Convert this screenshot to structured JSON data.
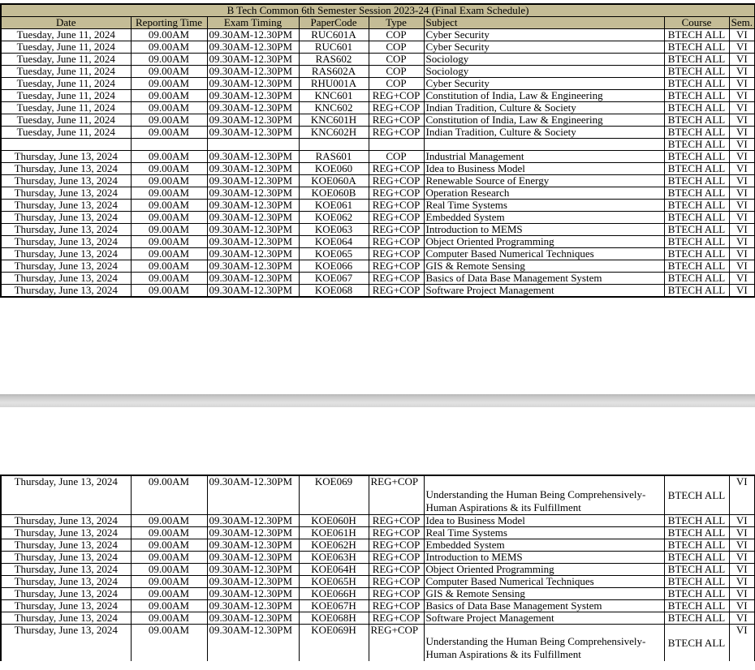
{
  "document": {
    "title": "B Tech Common 6th Semester  Session 2023-24 (Final Exam Schedule)",
    "columns": [
      "Date",
      "Reporting Time",
      "Exam Timing",
      "PaperCode",
      "Type",
      "Subject",
      "Course",
      "Sem."
    ]
  },
  "page1_rows": [
    {
      "date": "Tuesday, June 11, 2024",
      "reporting": "09.00AM",
      "timing": "09.30AM-12.30PM",
      "code": "RUC601A",
      "type": "COP",
      "subject": "Cyber Security",
      "course": "BTECH ALL",
      "sem": "VI"
    },
    {
      "date": "Tuesday, June 11, 2024",
      "reporting": "09.00AM",
      "timing": "09.30AM-12.30PM",
      "code": "RUC601",
      "type": "COP",
      "subject": "Cyber Security",
      "course": "BTECH ALL",
      "sem": "VI"
    },
    {
      "date": "Tuesday, June 11, 2024",
      "reporting": "09.00AM",
      "timing": "09.30AM-12.30PM",
      "code": "RAS602",
      "type": "COP",
      "subject": "Sociology",
      "course": "BTECH ALL",
      "sem": "VI"
    },
    {
      "date": "Tuesday, June 11, 2024",
      "reporting": "09.00AM",
      "timing": "09.30AM-12.30PM",
      "code": "RAS602A",
      "type": "COP",
      "subject": "Sociology",
      "course": "BTECH ALL",
      "sem": "VI"
    },
    {
      "date": "Tuesday, June 11, 2024",
      "reporting": "09.00AM",
      "timing": "09.30AM-12.30PM",
      "code": "RHU001A",
      "type": "COP",
      "subject": "Cyber Security",
      "course": "BTECH ALL",
      "sem": "VI"
    },
    {
      "date": "Tuesday, June 11, 2024",
      "reporting": "09.00AM",
      "timing": "09.30AM-12.30PM",
      "code": "KNC601",
      "type": "REG+COP",
      "subject": "Constitution of India, Law & Engineering",
      "course": "BTECH ALL",
      "sem": "VI"
    },
    {
      "date": "Tuesday, June 11, 2024",
      "reporting": "09.00AM",
      "timing": "09.30AM-12.30PM",
      "code": "KNC602",
      "type": "REG+COP",
      "subject": "Indian Tradition, Culture & Society",
      "course": "BTECH ALL",
      "sem": "VI"
    },
    {
      "date": "Tuesday, June 11, 2024",
      "reporting": "09.00AM",
      "timing": "09.30AM-12.30PM",
      "code": "KNC601H",
      "type": "REG+COP",
      "subject": "Constitution of India, Law & Engineering",
      "course": "BTECH ALL",
      "sem": "VI"
    },
    {
      "date": "Tuesday, June 11, 2024",
      "reporting": "09.00AM",
      "timing": "09.30AM-12.30PM",
      "code": "KNC602H",
      "type": "REG+COP",
      "subject": "Indian Tradition, Culture & Society",
      "course": "BTECH ALL",
      "sem": "VI"
    },
    {
      "date": "",
      "reporting": "",
      "timing": "",
      "code": "",
      "type": "",
      "subject": "",
      "course": "BTECH ALL",
      "sem": "VI"
    },
    {
      "date": "Thursday, June 13, 2024",
      "reporting": "09.00AM",
      "timing": "09.30AM-12.30PM",
      "code": "RAS601",
      "type": "COP",
      "subject": "Industrial Management",
      "course": "BTECH ALL",
      "sem": "VI"
    },
    {
      "date": "Thursday, June 13, 2024",
      "reporting": "09.00AM",
      "timing": "09.30AM-12.30PM",
      "code": "KOE060",
      "type": "REG+COP",
      "subject": "Idea to Business Model",
      "course": "BTECH ALL",
      "sem": "VI"
    },
    {
      "date": "Thursday, June 13, 2024",
      "reporting": "09.00AM",
      "timing": "09.30AM-12.30PM",
      "code": "KOE060A",
      "type": "REG+COP",
      "subject": "Renewable Source of Energy",
      "course": "BTECH ALL",
      "sem": "VI"
    },
    {
      "date": "Thursday, June 13, 2024",
      "reporting": "09.00AM",
      "timing": "09.30AM-12.30PM",
      "code": "KOE060B",
      "type": "REG+COP",
      "subject": "Operation Research",
      "course": "BTECH ALL",
      "sem": "VI"
    },
    {
      "date": "Thursday, June 13, 2024",
      "reporting": "09.00AM",
      "timing": "09.30AM-12.30PM",
      "code": "KOE061",
      "type": "REG+COP",
      "subject": "Real Time Systems",
      "course": "BTECH ALL",
      "sem": "VI"
    },
    {
      "date": "Thursday, June 13, 2024",
      "reporting": "09.00AM",
      "timing": "09.30AM-12.30PM",
      "code": "KOE062",
      "type": "REG+COP",
      "subject": "Embedded System",
      "course": "BTECH ALL",
      "sem": "VI"
    },
    {
      "date": "Thursday, June 13, 2024",
      "reporting": "09.00AM",
      "timing": "09.30AM-12.30PM",
      "code": "KOE063",
      "type": "REG+COP",
      "subject": "Introduction to MEMS",
      "course": "BTECH ALL",
      "sem": "VI"
    },
    {
      "date": "Thursday, June 13, 2024",
      "reporting": "09.00AM",
      "timing": "09.30AM-12.30PM",
      "code": "KOE064",
      "type": "REG+COP",
      "subject": "Object Oriented Programming",
      "course": "BTECH ALL",
      "sem": "VI"
    },
    {
      "date": "Thursday, June 13, 2024",
      "reporting": "09.00AM",
      "timing": "09.30AM-12.30PM",
      "code": "KOE065",
      "type": "REG+COP",
      "subject": "Computer Based Numerical Techniques",
      "course": "BTECH ALL",
      "sem": "VI"
    },
    {
      "date": "Thursday, June 13, 2024",
      "reporting": "09.00AM",
      "timing": "09.30AM-12.30PM",
      "code": "KOE066",
      "type": "REG+COP",
      "subject": "GIS & Remote Sensing",
      "course": "BTECH ALL",
      "sem": "VI"
    },
    {
      "date": "Thursday, June 13, 2024",
      "reporting": "09.00AM",
      "timing": "09.30AM-12.30PM",
      "code": "KOE067",
      "type": "REG+COP",
      "subject": "Basics of Data Base Management System",
      "course": "BTECH ALL",
      "sem": "VI"
    },
    {
      "date": "Thursday, June 13, 2024",
      "reporting": "09.00AM",
      "timing": "09.30AM-12.30PM",
      "code": "KOE068",
      "type": "REG+COP",
      "subject": "Software Project Management",
      "course": "BTECH ALL",
      "sem": "VI"
    }
  ],
  "page2_rows": [
    {
      "date": "Thursday, June 13, 2024",
      "reporting": "09.00AM",
      "timing": "09.30AM-12.30PM",
      "code": "KOE069",
      "type": "REG+COP",
      "subject": "Understanding the Human Being Comprehensively- Human Aspirations & its Fulfillment",
      "course": "BTECH ALL",
      "sem": "VI",
      "tall": true
    },
    {
      "date": "Thursday, June 13, 2024",
      "reporting": "09.00AM",
      "timing": "09.30AM-12.30PM",
      "code": "KOE060H",
      "type": "REG+COP",
      "subject": "Idea to Business Model",
      "course": "BTECH ALL",
      "sem": "VI"
    },
    {
      "date": "Thursday, June 13, 2024",
      "reporting": "09.00AM",
      "timing": "09.30AM-12.30PM",
      "code": "KOE061H",
      "type": "REG+COP",
      "subject": "Real Time Systems",
      "course": "BTECH ALL",
      "sem": "VI"
    },
    {
      "date": "Thursday, June 13, 2024",
      "reporting": "09.00AM",
      "timing": "09.30AM-12.30PM",
      "code": "KOE062H",
      "type": "REG+COP",
      "subject": "Embedded System",
      "course": "BTECH ALL",
      "sem": "VI"
    },
    {
      "date": "Thursday, June 13, 2024",
      "reporting": "09.00AM",
      "timing": "09.30AM-12.30PM",
      "code": "KOE063H",
      "type": "REG+COP",
      "subject": "Introduction to MEMS",
      "course": "BTECH ALL",
      "sem": "VI"
    },
    {
      "date": "Thursday, June 13, 2024",
      "reporting": "09.00AM",
      "timing": "09.30AM-12.30PM",
      "code": "KOE064H",
      "type": "REG+COP",
      "subject": "Object Oriented Programming",
      "course": "BTECH ALL",
      "sem": "VI"
    },
    {
      "date": "Thursday, June 13, 2024",
      "reporting": "09.00AM",
      "timing": "09.30AM-12.30PM",
      "code": "KOE065H",
      "type": "REG+COP",
      "subject": "Computer Based Numerical Techniques",
      "course": "BTECH ALL",
      "sem": "VI"
    },
    {
      "date": "Thursday, June 13, 2024",
      "reporting": "09.00AM",
      "timing": "09.30AM-12.30PM",
      "code": "KOE066H",
      "type": "REG+COP",
      "subject": "GIS & Remote Sensing",
      "course": "BTECH ALL",
      "sem": "VI"
    },
    {
      "date": "Thursday, June 13, 2024",
      "reporting": "09.00AM",
      "timing": "09.30AM-12.30PM",
      "code": "KOE067H",
      "type": "REG+COP",
      "subject": "Basics of Data Base Management System",
      "course": "BTECH ALL",
      "sem": "VI"
    },
    {
      "date": "Thursday, June 13, 2024",
      "reporting": "09.00AM",
      "timing": "09.30AM-12.30PM",
      "code": "KOE068H",
      "type": "REG+COP",
      "subject": "Software Project Management",
      "course": "BTECH ALL",
      "sem": "VI"
    },
    {
      "date": "Thursday, June 13, 2024",
      "reporting": "09.00AM",
      "timing": "09.30AM-12.30PM",
      "code": "KOE069H",
      "type": "REG+COP",
      "subject": "Understanding the Human Being Comprehensively- Human Aspirations & its Fulfillment",
      "course": "BTECH ALL",
      "sem": "VI",
      "tall": true,
      "cut": true
    }
  ],
  "colors": {
    "header_bg": "#c4bc96",
    "border": "#000000",
    "page_separator": "#d0d0d0"
  }
}
